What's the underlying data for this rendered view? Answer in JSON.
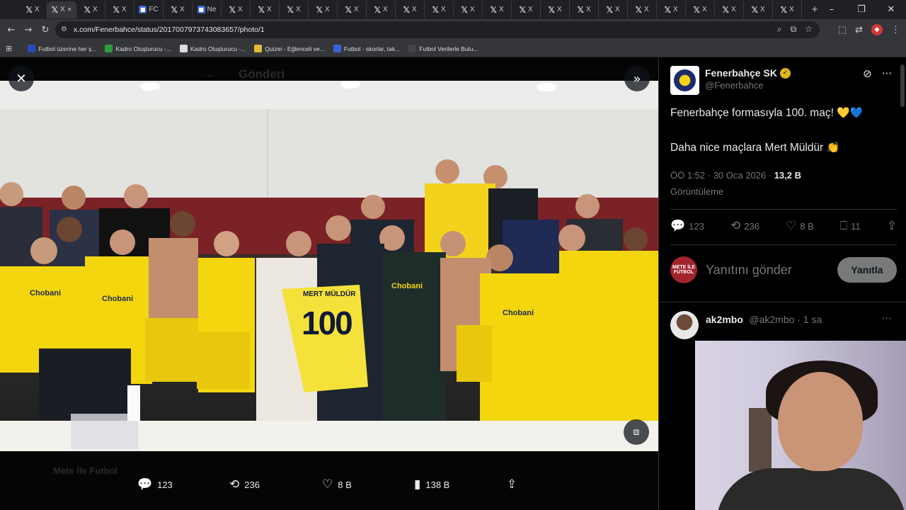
{
  "browser": {
    "tabs": [
      {
        "label": "X",
        "icon": "x-logo-icon"
      },
      {
        "label": "X",
        "icon": "x-logo-icon",
        "active": true
      },
      {
        "label": "X",
        "icon": "x-logo-icon"
      },
      {
        "label": "X",
        "icon": "x-logo-icon"
      },
      {
        "label": "FC",
        "icon": "site-icon"
      },
      {
        "label": "X",
        "icon": "x-logo-icon"
      },
      {
        "label": "Ne",
        "icon": "site-icon"
      },
      {
        "label": "X",
        "icon": "x-logo-icon"
      },
      {
        "label": "X",
        "icon": "x-logo-icon"
      },
      {
        "label": "X",
        "icon": "x-logo-icon"
      },
      {
        "label": "X",
        "icon": "x-logo-icon"
      },
      {
        "label": "X",
        "icon": "x-logo-icon"
      },
      {
        "label": "X",
        "icon": "x-logo-icon"
      },
      {
        "label": "X",
        "icon": "x-logo-icon"
      },
      {
        "label": "X",
        "icon": "x-logo-icon"
      },
      {
        "label": "X",
        "icon": "x-logo-icon"
      },
      {
        "label": "X",
        "icon": "x-logo-icon"
      },
      {
        "label": "X",
        "icon": "x-logo-icon"
      },
      {
        "label": "X",
        "icon": "x-logo-icon"
      },
      {
        "label": "X",
        "icon": "x-logo-icon"
      },
      {
        "label": "X",
        "icon": "x-logo-icon"
      },
      {
        "label": "X",
        "icon": "x-logo-icon"
      },
      {
        "label": "X",
        "icon": "x-logo-icon"
      },
      {
        "label": "X",
        "icon": "x-logo-icon"
      },
      {
        "label": "X",
        "icon": "x-logo-icon"
      },
      {
        "label": "X",
        "icon": "x-logo-icon"
      },
      {
        "label": "X",
        "icon": "x-logo-icon"
      }
    ],
    "url": "x.com/Fenerbahce/status/2017007973743083657/photo/1",
    "bookmarks": [
      {
        "label": "Futbol üzerine her ş...",
        "color": "#2a4bb7"
      },
      {
        "label": "Kadro Oluşturucu -...",
        "color": "#2e9c3c"
      },
      {
        "label": "Kadro Oluşturucu -...",
        "color": "#dddddd"
      },
      {
        "label": "Quizei - Eğlenceli ve...",
        "color": "#e0b93b"
      },
      {
        "label": "Futbol - skorlar, tak...",
        "color": "#3b62d6"
      },
      {
        "label": "Futbol Verilerle Bulu...",
        "color": "#444444"
      }
    ]
  },
  "viewer": {
    "ghost_header": "Gönderi",
    "ghost_user": "Mete İle Futbol",
    "jersey_name": "MERT MÜLDÜR",
    "jersey_number": "100",
    "sponsor": "Chobani",
    "actions": {
      "replies": "123",
      "reposts": "236",
      "likes": "8 B",
      "views": "138 B"
    }
  },
  "tweet": {
    "display_name": "Fenerbahçe SK",
    "handle": "@Fenerbahce",
    "line1": "Fenerbahçe formasıyla 100. maç!",
    "line1_emoji": "💛💙",
    "line2": "Daha nice maçlara Mert Müldür",
    "line2_emoji": "👏",
    "time": "ÖÖ 1:52 · 30 Oca 2026 · ",
    "views_count": "13,2 B",
    "views_label": "Görüntüleme",
    "stats": {
      "replies": "123",
      "reposts": "236",
      "likes": "8 B",
      "bookmarks": "11"
    },
    "reply_placeholder": "Yanıtını gönder",
    "reply_button": "Yanıtla",
    "reply_avatar_text": "METE İLE FUTBOL"
  },
  "reply": {
    "name": "ak2mbo",
    "handle": "@ak2mbo · 1 sa"
  },
  "colors": {
    "fb_yellow": "#f4d60e",
    "fb_navy": "#1b2b6b",
    "x_text": "#e7e9ea",
    "x_muted": "#71767b",
    "verified_gold": "#e2b719"
  }
}
